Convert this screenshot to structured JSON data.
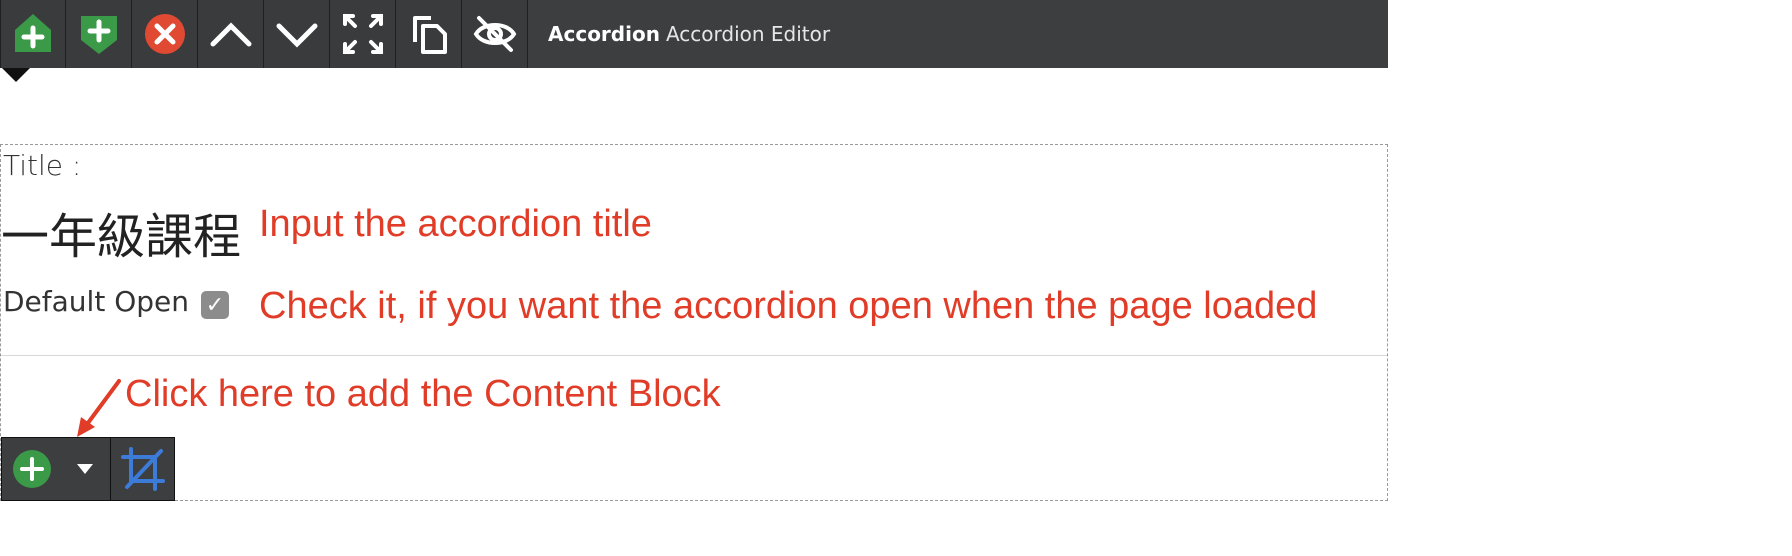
{
  "toolbar": {
    "title_strong": "Accordion",
    "title_rest": "Accordion Editor",
    "buttons": [
      "add-above",
      "add-below",
      "delete",
      "move-up",
      "move-down",
      "fullscreen",
      "duplicate",
      "hide"
    ]
  },
  "editor": {
    "title_label": "Title :",
    "title_value": "一年級課程",
    "title_note": "Input the accordion title",
    "default_open_label": "Default Open :",
    "default_open_checked": true,
    "default_open_note": "Check it, if you want the accordion open when the page loaded",
    "add_block_note": "Click here to add the Content Block"
  },
  "colors": {
    "toolbar_bg": "#3d3e40",
    "green": "#3a9a48",
    "red": "#e04a32",
    "annotation": "#e03c28",
    "crop_blue": "#3d7bd8"
  }
}
